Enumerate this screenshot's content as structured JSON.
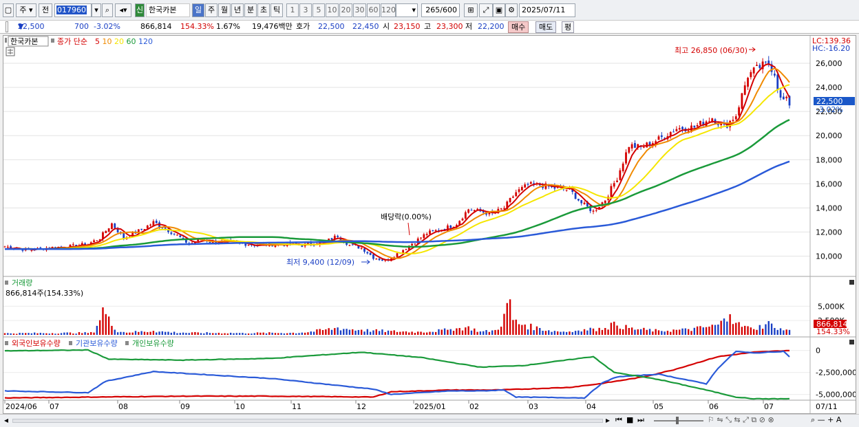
{
  "toolbar": {
    "market_label": "주",
    "prefix_label": "전",
    "code_value": "017960",
    "stock_name": "한국카본",
    "credit_badge": "신",
    "periods": [
      "일",
      "주",
      "월",
      "년",
      "분",
      "초",
      "틱"
    ],
    "selected_period": "일",
    "intervals": [
      "1",
      "3",
      "5",
      "10",
      "20",
      "30",
      "60",
      "120"
    ],
    "count_value": "265",
    "count_total": "/600",
    "date_value": "2025/07/11"
  },
  "quote": {
    "price": "22,500",
    "change": "700",
    "change_pct": "-3.02%",
    "volume": "866,814",
    "volume_ratio": "154.33%",
    "turnover_pct": "1.67%",
    "amount": "19,476백만",
    "hoga_label": "호가",
    "ask": "22,500",
    "bid": "22,450",
    "open_label": "시",
    "open": "23,150",
    "high_label": "고",
    "high": "23,300",
    "low_label": "저",
    "low": "22,200",
    "buy_button": "매수",
    "sell_button": "매도",
    "eval_button": "평"
  },
  "price_panel": {
    "name_tag": "한국카본",
    "legend_title": "종가 단순",
    "ma_periods": [
      "5",
      "10",
      "20",
      "60",
      "120"
    ],
    "ma_colors": [
      "#d40000",
      "#f08a00",
      "#f5e600",
      "#1a9a3a",
      "#2a5ad8"
    ],
    "lc_label": "LC:139.36",
    "hc_label": "HC:-16.20",
    "last_price_tag": "22,500",
    "last_pct_tag": "-3.02%",
    "annotation_high": "최고 26,850 (06/30)",
    "annotation_low": "최저 9,400 (12/09)",
    "annotation_dividend": "배당락(0.00%)"
  },
  "volume_panel": {
    "title": "거래량",
    "subtitle": "866,814주(154.33%)",
    "last_tag": "866,814",
    "last_pct_tag": "154.33%"
  },
  "holdings_panel": {
    "legend": [
      "외국인보유수량",
      "기관보유수량",
      "개인보유수량"
    ],
    "legend_colors": [
      "#d40000",
      "#2a5ad8",
      "#1a9a3a"
    ]
  },
  "x_axis_labels": [
    "2024/06",
    "07",
    "08",
    "09",
    "10",
    "11",
    "12",
    "2025/01",
    "02",
    "03",
    "04",
    "05",
    "06",
    "07"
  ],
  "x_axis_last": "07/11",
  "chart_data": {
    "type": "candlestick",
    "price_axis": {
      "ticks": [
        10000,
        12000,
        14000,
        16000,
        18000,
        20000,
        22000,
        24000,
        26000
      ],
      "labels": [
        "10,000",
        "12,000",
        "14,000",
        "16,000",
        "18,000",
        "20,000",
        "22,000",
        "24,000",
        "26,000"
      ],
      "ylim": [
        8600,
        27600
      ]
    },
    "volume_axis": {
      "ticks": [
        2500000,
        5000000
      ],
      "labels": [
        "2,500K",
        "5,000K"
      ],
      "ylim": [
        0,
        6600000
      ]
    },
    "holdings_axis": {
      "ticks": [
        0,
        -2500000,
        -5000000
      ],
      "labels": [
        "0",
        "-2,500,000",
        "-5,000,000"
      ],
      "ylim": [
        -5500000,
        600000
      ]
    },
    "close_waypoints": [
      [
        0,
        10800
      ],
      [
        8,
        10500
      ],
      [
        15,
        10700
      ],
      [
        22,
        10800
      ],
      [
        28,
        11000
      ],
      [
        32,
        11500
      ],
      [
        36,
        12700
      ],
      [
        40,
        11500
      ],
      [
        46,
        12200
      ],
      [
        50,
        12800
      ],
      [
        54,
        12300
      ],
      [
        58,
        11700
      ],
      [
        62,
        11000
      ],
      [
        66,
        11400
      ],
      [
        70,
        11200
      ],
      [
        78,
        11100
      ],
      [
        85,
        10900
      ],
      [
        92,
        11000
      ],
      [
        100,
        10900
      ],
      [
        108,
        11200
      ],
      [
        112,
        11700
      ],
      [
        116,
        10900
      ],
      [
        120,
        10700
      ],
      [
        124,
        9900
      ],
      [
        128,
        9600
      ],
      [
        132,
        10200
      ],
      [
        138,
        11200
      ],
      [
        142,
        11900
      ],
      [
        148,
        12300
      ],
      [
        152,
        12700
      ],
      [
        156,
        13900
      ],
      [
        160,
        13700
      ],
      [
        164,
        13500
      ],
      [
        168,
        14000
      ],
      [
        172,
        15300
      ],
      [
        176,
        15900
      ],
      [
        180,
        15900
      ],
      [
        186,
        15600
      ],
      [
        190,
        15500
      ],
      [
        194,
        14400
      ],
      [
        198,
        13700
      ],
      [
        202,
        14700
      ],
      [
        206,
        16500
      ],
      [
        210,
        19200
      ],
      [
        214,
        19000
      ],
      [
        220,
        19700
      ],
      [
        226,
        20600
      ],
      [
        232,
        20700
      ],
      [
        238,
        21500
      ],
      [
        242,
        20700
      ],
      [
        246,
        21700
      ],
      [
        250,
        25000
      ],
      [
        254,
        25700
      ],
      [
        257,
        26000
      ],
      [
        259,
        25200
      ],
      [
        261,
        23000
      ],
      [
        263,
        22900
      ],
      [
        264,
        22500
      ]
    ],
    "volume_waypoints": [
      [
        0,
        300
      ],
      [
        30,
        400
      ],
      [
        33,
        4800
      ],
      [
        35,
        3200
      ],
      [
        37,
        900
      ],
      [
        40,
        500
      ],
      [
        50,
        700
      ],
      [
        60,
        400
      ],
      [
        80,
        350
      ],
      [
        100,
        400
      ],
      [
        112,
        1300
      ],
      [
        120,
        900
      ],
      [
        130,
        700
      ],
      [
        140,
        550
      ],
      [
        150,
        1000
      ],
      [
        156,
        1500
      ],
      [
        160,
        600
      ],
      [
        166,
        900
      ],
      [
        170,
        6200
      ],
      [
        171,
        2600
      ],
      [
        175,
        1800
      ],
      [
        180,
        1200
      ],
      [
        186,
        600
      ],
      [
        192,
        700
      ],
      [
        198,
        1100
      ],
      [
        202,
        1200
      ],
      [
        205,
        2300
      ],
      [
        210,
        1200
      ],
      [
        220,
        800
      ],
      [
        230,
        1000
      ],
      [
        240,
        1800
      ],
      [
        244,
        3600
      ],
      [
        246,
        2100
      ],
      [
        252,
        1000
      ],
      [
        257,
        2400
      ],
      [
        259,
        1200
      ],
      [
        264,
        866
      ]
    ],
    "foreign_holdings": [
      [
        0,
        -5400000
      ],
      [
        30,
        -5300000
      ],
      [
        60,
        -5200000
      ],
      [
        90,
        -5200000
      ],
      [
        124,
        -5300000
      ],
      [
        130,
        -4700000
      ],
      [
        150,
        -4500000
      ],
      [
        166,
        -4500000
      ],
      [
        190,
        -4200000
      ],
      [
        200,
        -3800000
      ],
      [
        215,
        -3000000
      ],
      [
        225,
        -2200000
      ],
      [
        240,
        -700000
      ],
      [
        252,
        -200000
      ],
      [
        264,
        0
      ]
    ],
    "institution_holdings": [
      [
        0,
        -4600000
      ],
      [
        28,
        -4800000
      ],
      [
        34,
        -3500000
      ],
      [
        50,
        -2400000
      ],
      [
        70,
        -2800000
      ],
      [
        90,
        -3200000
      ],
      [
        124,
        -4400000
      ],
      [
        130,
        -5000000
      ],
      [
        150,
        -4600000
      ],
      [
        160,
        -4600000
      ],
      [
        168,
        -4500000
      ],
      [
        172,
        -5300000
      ],
      [
        195,
        -5400000
      ],
      [
        201,
        -3700000
      ],
      [
        206,
        -3000000
      ],
      [
        220,
        -2700000
      ],
      [
        236,
        -3800000
      ],
      [
        240,
        -2000000
      ],
      [
        246,
        -100000
      ],
      [
        252,
        -300000
      ],
      [
        262,
        -100000
      ],
      [
        264,
        -700000
      ]
    ],
    "individual_holdings": [
      [
        0,
        -50000
      ],
      [
        28,
        50000
      ],
      [
        35,
        -1000000
      ],
      [
        60,
        -1100000
      ],
      [
        90,
        -900000
      ],
      [
        120,
        -200000
      ],
      [
        140,
        -800000
      ],
      [
        160,
        -1900000
      ],
      [
        175,
        -1700000
      ],
      [
        198,
        -700000
      ],
      [
        205,
        -2500000
      ],
      [
        220,
        -3300000
      ],
      [
        236,
        -4500000
      ],
      [
        246,
        -5300000
      ],
      [
        252,
        -5500000
      ],
      [
        264,
        -5500000
      ]
    ]
  }
}
